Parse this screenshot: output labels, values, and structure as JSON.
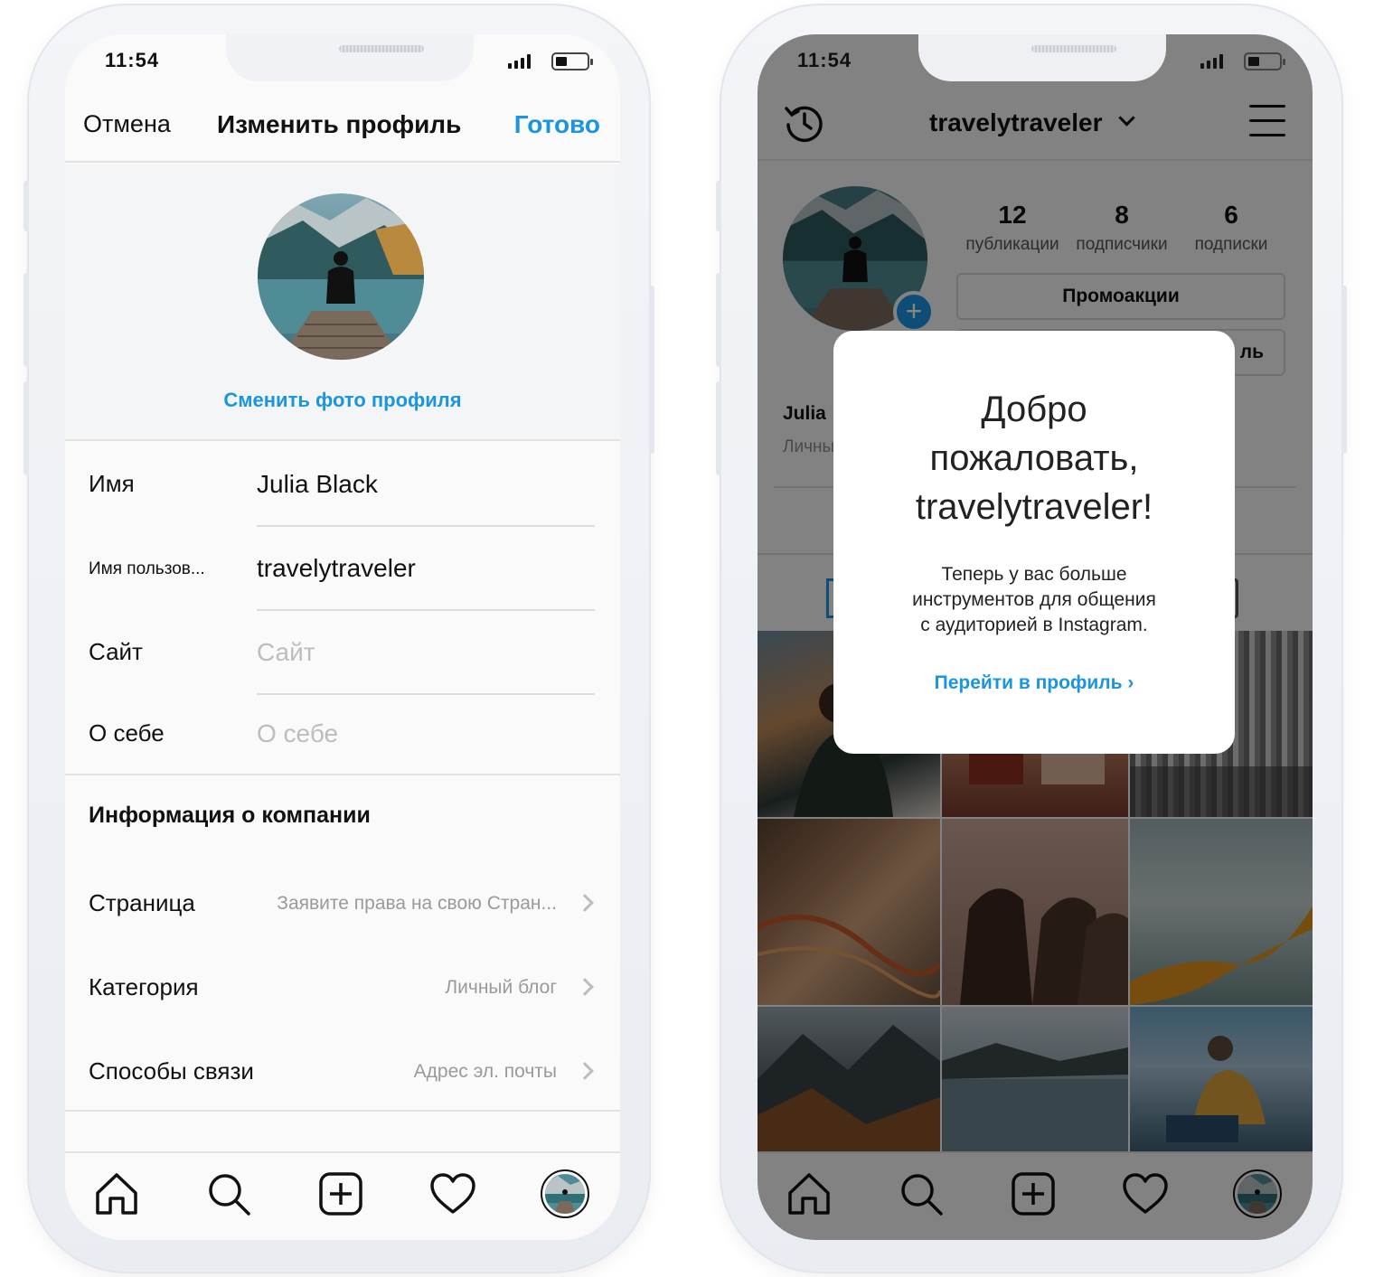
{
  "status": {
    "time_left": "11:54",
    "time_right": "11:54"
  },
  "edit_profile": {
    "nav": {
      "cancel": "Отмена",
      "title": "Изменить профиль",
      "done": "Готово"
    },
    "change_photo": "Сменить фото профиля",
    "fields": [
      {
        "label": "Имя",
        "value": "Julia Black",
        "placeholder": ""
      },
      {
        "label": "Имя пользов...",
        "value": "travelytraveler",
        "placeholder": ""
      },
      {
        "label": "Сайт",
        "value": "",
        "placeholder": "Сайт"
      },
      {
        "label": "О себе",
        "value": "",
        "placeholder": "О себе"
      }
    ],
    "company_title": "Информация о компании",
    "rows": [
      {
        "label": "Страница",
        "value": "Заявите права на свою Стран..."
      },
      {
        "label": "Категория",
        "value": "Личный блог"
      },
      {
        "label": "Способы связи",
        "value": "Адрес эл. почты"
      }
    ]
  },
  "profile": {
    "username": "travelytraveler",
    "stats": [
      {
        "num": "12",
        "caption": "публикации"
      },
      {
        "num": "8",
        "caption": "подписчики"
      },
      {
        "num": "6",
        "caption": "подписки"
      }
    ],
    "promo_button": "Промоакции",
    "edit_button_partial": "ль",
    "bio_name": "Julia",
    "bio_category": "Личны"
  },
  "modal": {
    "title_line1": "Добро",
    "title_line2": "пожаловать,",
    "title_line3": "travelytraveler!",
    "text_line1": "Теперь у вас больше",
    "text_line2": "инструментов для общения",
    "text_line3": "с аудиторией в Instagram.",
    "link": "Перейти в профиль ›"
  },
  "tabbar_icons": [
    "home-icon",
    "search-icon",
    "add-post-icon",
    "heart-icon",
    "profile-avatar"
  ],
  "colors": {
    "accent": "#1b95e0",
    "text": "#111111",
    "placeholder": "#bdbdbd"
  }
}
